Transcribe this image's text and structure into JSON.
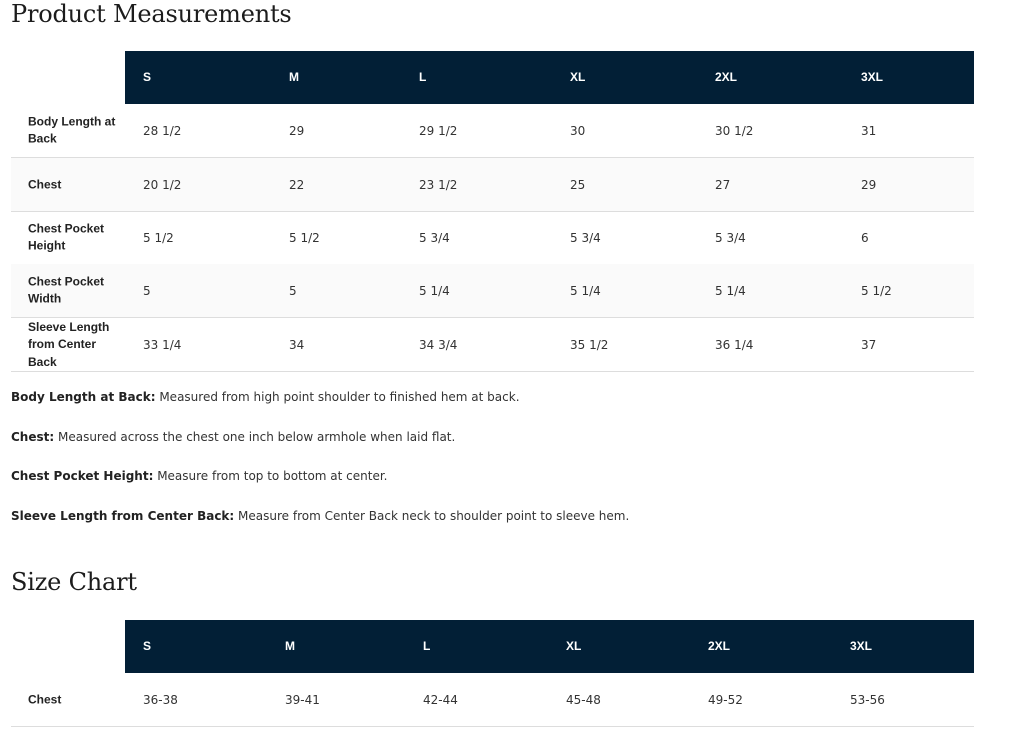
{
  "measurements": {
    "title": "Product Measurements",
    "sizes": [
      "S",
      "M",
      "L",
      "XL",
      "2XL",
      "3XL"
    ],
    "rows": [
      {
        "label": "Body Length at Back",
        "values": [
          "28 1/2",
          "29",
          "29 1/2",
          "30",
          "30 1/2",
          "31"
        ]
      },
      {
        "label": "Chest",
        "values": [
          "20 1/2",
          "22",
          "23 1/2",
          "25",
          "27",
          "29"
        ]
      },
      {
        "label": "Chest Pocket Height",
        "values": [
          "5 1/2",
          "5 1/2",
          "5 3/4",
          "5 3/4",
          "5 3/4",
          "6"
        ]
      },
      {
        "label": "Chest Pocket Width",
        "values": [
          "5",
          "5",
          "5 1/4",
          "5 1/4",
          "5 1/4",
          "5 1/2"
        ]
      },
      {
        "label": "Sleeve Length from Center Back",
        "values": [
          "33 1/4",
          "34",
          "34 3/4",
          "35 1/2",
          "36 1/4",
          "37"
        ]
      }
    ]
  },
  "notes": [
    {
      "term": "Body Length at Back:",
      "text": " Measured from high point shoulder to finished hem at back."
    },
    {
      "term": "Chest:",
      "text": " Measured across the chest one inch below armhole when laid flat."
    },
    {
      "term": "Chest Pocket Height:",
      "text": " Measure from top to bottom at center."
    },
    {
      "term": "Sleeve Length from Center Back:",
      "text": " Measure from Center Back neck to shoulder point to sleeve hem."
    }
  ],
  "size_chart": {
    "title": "Size Chart",
    "sizes": [
      "S",
      "M",
      "L",
      "XL",
      "2XL",
      "3XL"
    ],
    "rows": [
      {
        "label": "Chest",
        "values": [
          "36-38",
          "39-41",
          "42-44",
          "45-48",
          "49-52",
          "53-56"
        ]
      }
    ]
  },
  "colors": {
    "header_bg": "#021f36",
    "header_text": "#ffffff",
    "row_alt": "#fafafa",
    "border": "#dddddd"
  }
}
